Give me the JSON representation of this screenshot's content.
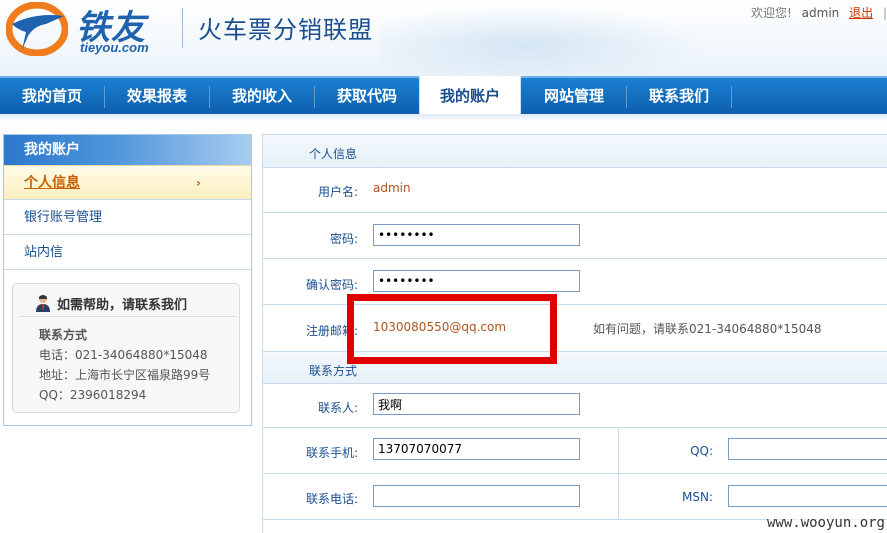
{
  "header": {
    "logo_cn": "铁友",
    "logo_en": "tieyou.com",
    "site_title": "火车票分销联盟",
    "welcome": "欢迎您!",
    "username": "admin",
    "logout": "退出",
    "extra": "|"
  },
  "nav": {
    "items": [
      "我的首页",
      "效果报表",
      "我的收入",
      "获取代码",
      "我的账户",
      "网站管理",
      "联系我们"
    ],
    "active": "我的账户"
  },
  "sidebar": {
    "title": "我的账户",
    "items": [
      "个人信息",
      "银行账号管理",
      "站内信"
    ],
    "chevron": "›",
    "help": {
      "title": "如需帮助，请联系我们",
      "subtitle": "联系方式",
      "phone": "电话：021-34064880*15048",
      "address": "地址：上海市长宁区福泉路99号",
      "qq": "QQ：2396018294"
    }
  },
  "form": {
    "section1": "个人信息",
    "username_label": "用户名:",
    "username_value": "admin",
    "password_label": "密码:",
    "password_value": "••••••••",
    "confirm_label": "确认密码:",
    "confirm_value": "••••••••",
    "email_label": "注册邮箱:",
    "email_value": "1030080550@qq.com",
    "email_hint": "如有问题，请联系021-34064880*15048",
    "section2": "联系方式",
    "contact_label": "联系人:",
    "contact_value": "我啊",
    "mobile_label": "联系手机:",
    "mobile_value": "13707070077",
    "qq_label": "QQ:",
    "qq_value": "",
    "phone_label": "联系电话:",
    "phone_value": "",
    "msn_label": "MSN:",
    "msn_value": ""
  },
  "watermark": "www.wooyun.org",
  "colors": {
    "nav_blue": "#0d5fae",
    "highlight_red": "#e00000",
    "link_orange": "#c85f00"
  }
}
